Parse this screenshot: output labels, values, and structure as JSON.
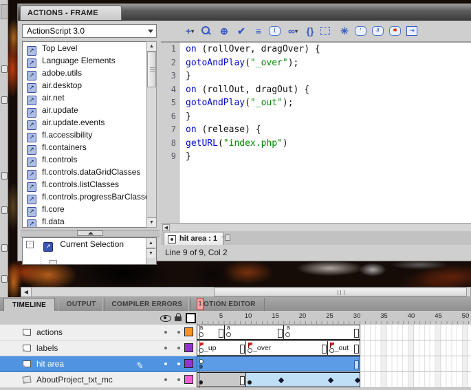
{
  "actions_panel": {
    "tab_title": "ACTIONS - FRAME",
    "language_selector": {
      "value": "ActionScript 3.0"
    },
    "class_list": [
      "Top Level",
      "Language Elements",
      "adobe.utils",
      "air.desktop",
      "air.net",
      "air.update",
      "air.update.events",
      "fl.accessibility",
      "fl.containers",
      "fl.controls",
      "fl.controls.dataGridClasses",
      "fl.controls.listClasses",
      "fl.controls.progressBarClasses",
      "fl.core",
      "fl.data"
    ],
    "class_item_icon": "script-package-icon",
    "class_item_glyph": "↗",
    "tree": {
      "root_label": "Current Selection",
      "expander": "-"
    },
    "toolbar_icons": [
      {
        "name": "add-item-icon",
        "style": "glyph",
        "glyph": "+",
        "extra": "▾"
      },
      {
        "name": "find-icon",
        "style": "mag",
        "glyph": ""
      },
      {
        "name": "insert-target-path-icon",
        "style": "glyph",
        "glyph": "⊕"
      },
      {
        "name": "check-syntax-icon",
        "style": "glyph",
        "glyph": "✔"
      },
      {
        "name": "auto-format-icon",
        "style": "glyph",
        "glyph": "≡"
      },
      {
        "name": "show-code-hint-icon",
        "style": "bubble",
        "glyph": "("
      },
      {
        "name": "debug-options-icon",
        "style": "glyph",
        "glyph": "∞",
        "extra": "▾"
      },
      {
        "name": "collapse-between-braces-icon",
        "style": "glyph",
        "glyph": "{}"
      },
      {
        "name": "collapse-selection-icon",
        "style": "dottedbox",
        "glyph": ""
      },
      {
        "name": "expand-all-icon",
        "style": "glyph",
        "glyph": "✳"
      },
      {
        "name": "apply-block-comment-icon",
        "style": "bubble",
        "glyph": "'"
      },
      {
        "name": "apply-line-comment-icon",
        "style": "bubble",
        "glyph": "//"
      },
      {
        "name": "remove-comment-icon",
        "style": "bubble red",
        "glyph": "✱"
      },
      {
        "name": "show-hide-toolbox-icon",
        "style": "boxarrow",
        "glyph": "⇥"
      }
    ],
    "code": {
      "token_colors": {
        "keyword": "#0008C7",
        "string": "#008800",
        "plain": "#111111"
      },
      "lines": [
        {
          "num": "1",
          "segs": [
            {
              "c": "k",
              "t": "on"
            },
            {
              "c": "p",
              "t": " (rollOver, dragOver) {"
            }
          ]
        },
        {
          "num": "2",
          "segs": [
            {
              "c": "k",
              "t": "gotoAndPlay"
            },
            {
              "c": "p",
              "t": "("
            },
            {
              "c": "s",
              "t": "\"_over\""
            },
            {
              "c": "p",
              "t": ");"
            }
          ]
        },
        {
          "num": "3",
          "segs": [
            {
              "c": "p",
              "t": "}"
            }
          ]
        },
        {
          "num": "4",
          "segs": [
            {
              "c": "k",
              "t": "on"
            },
            {
              "c": "p",
              "t": " (rollOut, dragOut) {"
            }
          ]
        },
        {
          "num": "5",
          "segs": [
            {
              "c": "k",
              "t": "gotoAndPlay"
            },
            {
              "c": "p",
              "t": "("
            },
            {
              "c": "s",
              "t": "\"_out\""
            },
            {
              "c": "p",
              "t": ");"
            }
          ]
        },
        {
          "num": "6",
          "segs": [
            {
              "c": "p",
              "t": "}"
            }
          ]
        },
        {
          "num": "7",
          "segs": [
            {
              "c": "k",
              "t": "on"
            },
            {
              "c": "p",
              "t": " (release) {"
            }
          ]
        },
        {
          "num": "8",
          "segs": [
            {
              "c": "k",
              "t": "getURL"
            },
            {
              "c": "p",
              "t": "("
            },
            {
              "c": "s",
              "t": "\"index.php\""
            },
            {
              "c": "p",
              "t": ")"
            }
          ]
        },
        {
          "num": "9",
          "segs": [
            {
              "c": "p",
              "t": "}"
            }
          ]
        }
      ]
    },
    "script_tab": {
      "label": "hit area : 1",
      "icon": "button-symbol-icon",
      "pin_icon": "pin-script-icon"
    },
    "status_text": "Line 9 of 9, Col 2"
  },
  "timeline": {
    "tabs": [
      {
        "label": "TIMELINE",
        "active": true
      },
      {
        "label": "OUTPUT",
        "active": false
      },
      {
        "label": "COMPILER ERRORS",
        "active": false
      },
      {
        "label": "MOTION EDITOR",
        "active": false
      }
    ],
    "header_icons": [
      "show-hide-all-layers-icon",
      "lock-unlock-all-layers-icon",
      "show-all-layers-as-outlines-icon"
    ],
    "ruler_numbers": [
      5,
      10,
      15,
      20,
      25,
      30,
      35,
      40,
      45,
      50
    ],
    "playhead_frame": "1",
    "frame_marker_letter": "a",
    "layers": [
      {
        "name": "actions",
        "icon": "layer-icon",
        "selected": false,
        "swatch": "#F7941D",
        "spans": [
          {
            "start": 1,
            "end": 5,
            "type": "plain",
            "kf": "a",
            "endrect": true
          },
          {
            "start": 6,
            "end": 16,
            "type": "plain",
            "kf": "a",
            "endrect": true
          },
          {
            "start": 17,
            "end": 30,
            "type": "plain",
            "kf": "a",
            "endrect": true
          }
        ]
      },
      {
        "name": "labels",
        "icon": "layer-icon",
        "selected": false,
        "swatch": "#9136C9",
        "spans": [
          {
            "start": 1,
            "end": 9,
            "type": "plain",
            "kf": "flag",
            "label": "_up",
            "endrect": true
          },
          {
            "start": 10,
            "end": 24,
            "type": "plain",
            "kf": "flag",
            "label": "_over",
            "endrect": true
          },
          {
            "start": 25,
            "end": 30,
            "type": "plain",
            "kf": "flag",
            "label": "_out",
            "endrect": true
          }
        ]
      },
      {
        "name": "hit area",
        "icon": "layer-icon",
        "selected": true,
        "swatch": "#9136C9",
        "pencil": true,
        "spans": [
          {
            "start": 1,
            "end": 30,
            "type": "selected",
            "kf": "dot2",
            "endrect": true
          }
        ]
      },
      {
        "name": "AboutProject_txt_mc",
        "icon": "layer-alt-icon",
        "selected": false,
        "swatch": "#F05FD5",
        "spans": [
          {
            "start": 1,
            "end": 9,
            "type": "static",
            "kf": "dot",
            "endrect": true
          },
          {
            "start": 10,
            "end": 30,
            "type": "tween",
            "kf": "dot",
            "diamonds": [
              16,
              25,
              30
            ]
          }
        ]
      }
    ]
  }
}
